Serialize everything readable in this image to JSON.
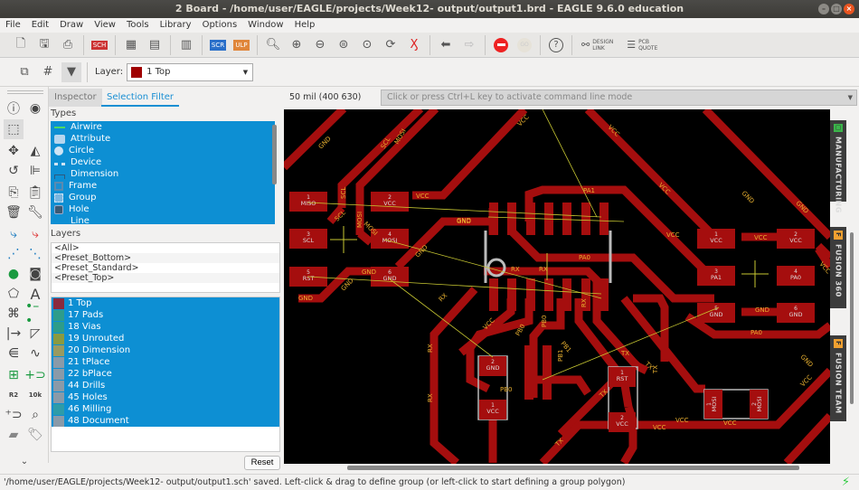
{
  "window": {
    "title": "2 Board - /home/user/EAGLE/projects/Week12- output/output1.brd - EAGLE 9.6.0 education"
  },
  "menu": [
    "File",
    "Edit",
    "Draw",
    "View",
    "Tools",
    "Library",
    "Options",
    "Window",
    "Help"
  ],
  "toolbar": {
    "design_link": "DESIGN LINK",
    "pcb_quote": "PCB QUOTE",
    "sch_label": "SCH",
    "scr_label": "SCR",
    "ulp_label": "ULP",
    "go_label": "GO"
  },
  "layer_bar": {
    "label": "Layer:",
    "selected": "1 Top",
    "selected_color": "#a00000"
  },
  "panel": {
    "tabs": [
      {
        "label": "Inspector",
        "active": false
      },
      {
        "label": "Selection Filter",
        "active": true
      }
    ],
    "types_label": "Types",
    "types": [
      "Airwire",
      "Attribute",
      "Circle",
      "Device",
      "Dimension",
      "Frame",
      "Group",
      "Hole",
      "Line"
    ],
    "layers_label": "Layers",
    "presets": [
      "<All>",
      "<Preset_Bottom>",
      "<Preset_Standard>",
      "<Preset_Top>"
    ],
    "layers": [
      {
        "name": "1 Top",
        "color": "#8b2a3e"
      },
      {
        "name": "17 Pads",
        "color": "#2e9c8a"
      },
      {
        "name": "18 Vias",
        "color": "#2e9c8a"
      },
      {
        "name": "19 Unrouted",
        "color": "#8a9a40"
      },
      {
        "name": "20 Dimension",
        "color": "#9a9a60"
      },
      {
        "name": "21 tPlace",
        "color": "#8a9aa8"
      },
      {
        "name": "22 bPlace",
        "color": "#8a9aa8"
      },
      {
        "name": "44 Drills",
        "color": "#8a9aa8"
      },
      {
        "name": "45 Holes",
        "color": "#8a9aa8"
      },
      {
        "name": "46 Milling",
        "color": "#2e9ca8"
      },
      {
        "name": "48 Document",
        "color": "#8a9aa8"
      }
    ],
    "reset_label": "Reset"
  },
  "coordinate": "50 mil (400 630)",
  "command_placeholder": "Click or press Ctrl+L key to activate command line mode",
  "right_tabs": [
    "MANUFACTURING",
    "FUSION 360",
    "FUSION TEAM"
  ],
  "status": "'/home/user/EAGLE/projects/Week12- output/output1.sch' saved. Left-click & drag to define group (or left-click to start defining a group polygon)",
  "board": {
    "pads": [
      {
        "num": "1",
        "net": "MISO"
      },
      {
        "num": "2",
        "net": "VCC"
      },
      {
        "num": "3",
        "net": "SCL"
      },
      {
        "num": "4",
        "net": "MOSI"
      },
      {
        "num": "5",
        "net": "RST"
      },
      {
        "num": "6",
        "net": "GND"
      },
      {
        "num": "1",
        "net": "VCC"
      },
      {
        "num": "2",
        "net": "VCC"
      },
      {
        "num": "3",
        "net": "PA1"
      },
      {
        "num": "4",
        "net": "PA0"
      },
      {
        "num": "5",
        "net": "GND"
      },
      {
        "num": "6",
        "net": "GND"
      },
      {
        "num": "2",
        "net": "GND"
      },
      {
        "num": "1",
        "net": "VCC"
      },
      {
        "num": "1",
        "net": "RST"
      },
      {
        "num": "2",
        "net": "VCC"
      },
      {
        "num": "1",
        "net": "MOSI"
      },
      {
        "num": "2",
        "net": "MOSI"
      }
    ],
    "trace_labels": [
      "GND",
      "SCL",
      "MOSI",
      "VCC",
      "VCC",
      "VCC",
      "GND",
      "GND",
      "PA1",
      "PA0",
      "RX",
      "RX",
      "PB0",
      "PB1",
      "RST",
      "TX",
      "MOSI",
      "VCC",
      "GND",
      "PA0",
      "TX",
      "VCC",
      "PB0",
      "GND"
    ]
  }
}
